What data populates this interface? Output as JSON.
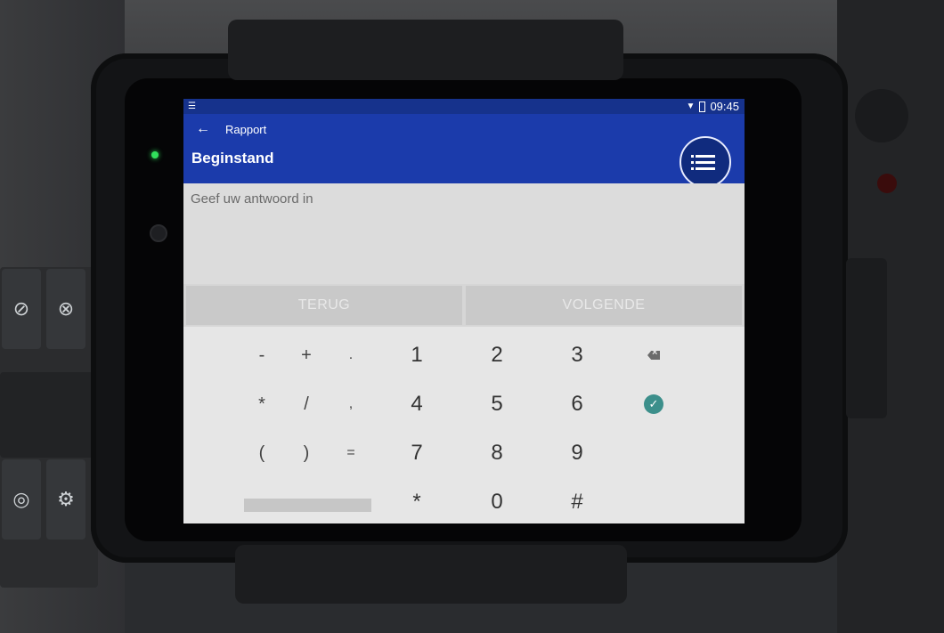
{
  "status_bar": {
    "menu_icon": "list-icon",
    "time": "09:45",
    "icons": [
      "wifi-icon",
      "battery-icon"
    ]
  },
  "header": {
    "back_icon": "arrow-left-icon",
    "breadcrumb": "Rapport",
    "title": "Beginstand",
    "menu_button_icon": "list-menu-icon"
  },
  "answer": {
    "placeholder": "Geef uw antwoord in",
    "value": ""
  },
  "nav": {
    "back_label": "TERUG",
    "next_label": "VOLGENDE"
  },
  "keypad": {
    "row1": [
      "-",
      "+",
      ".",
      "1",
      "2",
      "3"
    ],
    "row2": [
      "*",
      "/",
      ",",
      "4",
      "5",
      "6"
    ],
    "row3": [
      "(",
      ")",
      "=",
      "7",
      "8",
      "9"
    ],
    "row4": [
      "*",
      "0",
      "#"
    ],
    "backspace_icon": "backspace-icon",
    "confirm_icon": "check-circle-icon"
  },
  "colors": {
    "app_bar": "#1b3bab",
    "status_bar": "#16328c",
    "confirm": "#3c8f8b"
  }
}
